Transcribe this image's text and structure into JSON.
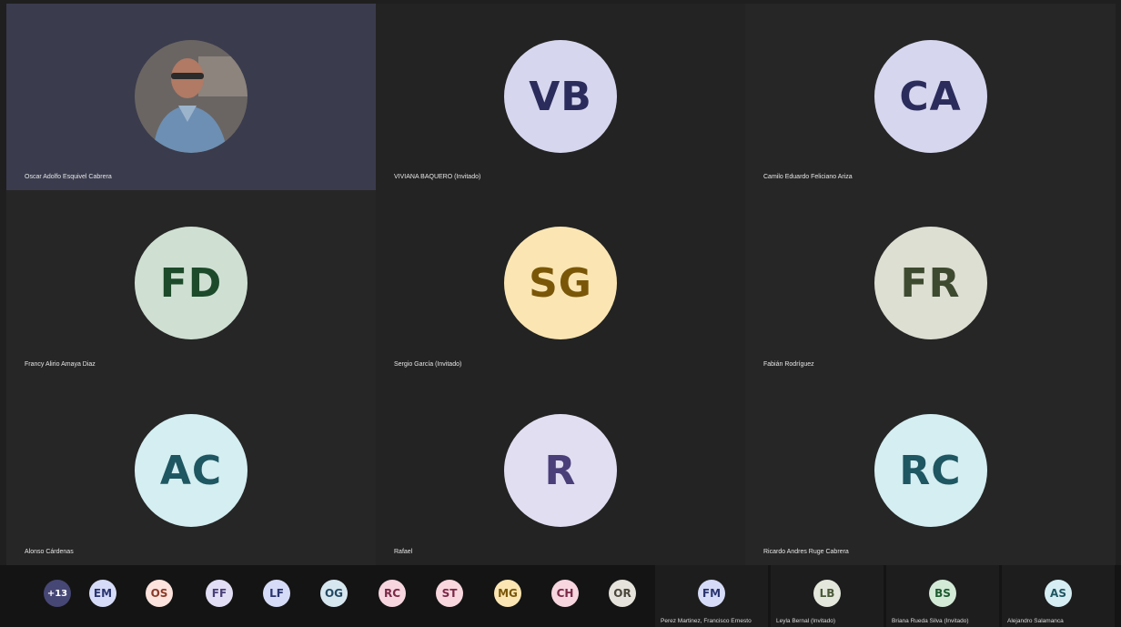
{
  "tiles": [
    {
      "name": "Oscar Adolfo Esquivel Cabrera",
      "initials": "",
      "video": true,
      "bg": "#c9c9e6",
      "fg": "#2b2b5a"
    },
    {
      "name": "VIVIANA BAQUERO (Invitado)",
      "initials": "VB",
      "bg": "#d6d6ef",
      "fg": "#2b2c5c"
    },
    {
      "name": "Camilo Eduardo Feliciano Ariza",
      "initials": "CA",
      "bg": "#d6d6ef",
      "fg": "#2b2c5c"
    },
    {
      "name": "Francy Alirio Amaya Diaz",
      "initials": "FD",
      "bg": "#cfe0d3",
      "fg": "#1d4a2a"
    },
    {
      "name": "Sergio García (Invitado)",
      "initials": "SG",
      "bg": "#fbe6b3",
      "fg": "#7a5708"
    },
    {
      "name": "Fabián Rodríguez",
      "initials": "FR",
      "bg": "#dcdfd2",
      "fg": "#3e4a30"
    },
    {
      "name": "Alonso Cárdenas",
      "initials": "AC",
      "bg": "#d4eef2",
      "fg": "#1e5661"
    },
    {
      "name": "Rafael",
      "initials": "R",
      "bg": "#e2def2",
      "fg": "#4a3f78"
    },
    {
      "name": "Ricardo Andres Ruge Cabrera",
      "initials": "RC",
      "bg": "#d4eef2",
      "fg": "#1e5661"
    }
  ],
  "overflow": {
    "more_label": "+13",
    "chips": [
      {
        "initials": "EM",
        "bg": "#d6dbf7",
        "fg": "#2a3570"
      },
      {
        "initials": "OS",
        "bg": "#fde3dd",
        "fg": "#8a3a2a"
      },
      {
        "initials": "FF",
        "bg": "#e2def5",
        "fg": "#4a3f78"
      },
      {
        "initials": "LF",
        "bg": "#d6dbf7",
        "fg": "#2a3570"
      },
      {
        "initials": "OG",
        "bg": "#d7e7f0",
        "fg": "#234a63"
      },
      {
        "initials": "RC",
        "bg": "#f7d6e0",
        "fg": "#7a2946"
      },
      {
        "initials": "ST",
        "bg": "#f9d7df",
        "fg": "#7a2946"
      },
      {
        "initials": "MG",
        "bg": "#fbe6b3",
        "fg": "#7a5708"
      },
      {
        "initials": "CH",
        "bg": "#f7d6e0",
        "fg": "#7a2946"
      },
      {
        "initials": "OR",
        "bg": "#e6e3dc",
        "fg": "#4b463a"
      }
    ]
  },
  "mini_tiles": [
    {
      "name": "Perez Martinez, Francisco Ernesto",
      "initials": "FM",
      "bg": "#d6dbf7",
      "fg": "#2a3570"
    },
    {
      "name": "Leyla Bernal (Invitado)",
      "initials": "LB",
      "bg": "#e4e8dc",
      "fg": "#4b5a38"
    },
    {
      "name": "Briana Rueda Silva (Invitado)",
      "initials": "BS",
      "bg": "#d3ead7",
      "fg": "#1d5a2f"
    },
    {
      "name": "Alejandro Salamanca",
      "initials": "AS",
      "bg": "#d6eef3",
      "fg": "#1e5661"
    }
  ]
}
